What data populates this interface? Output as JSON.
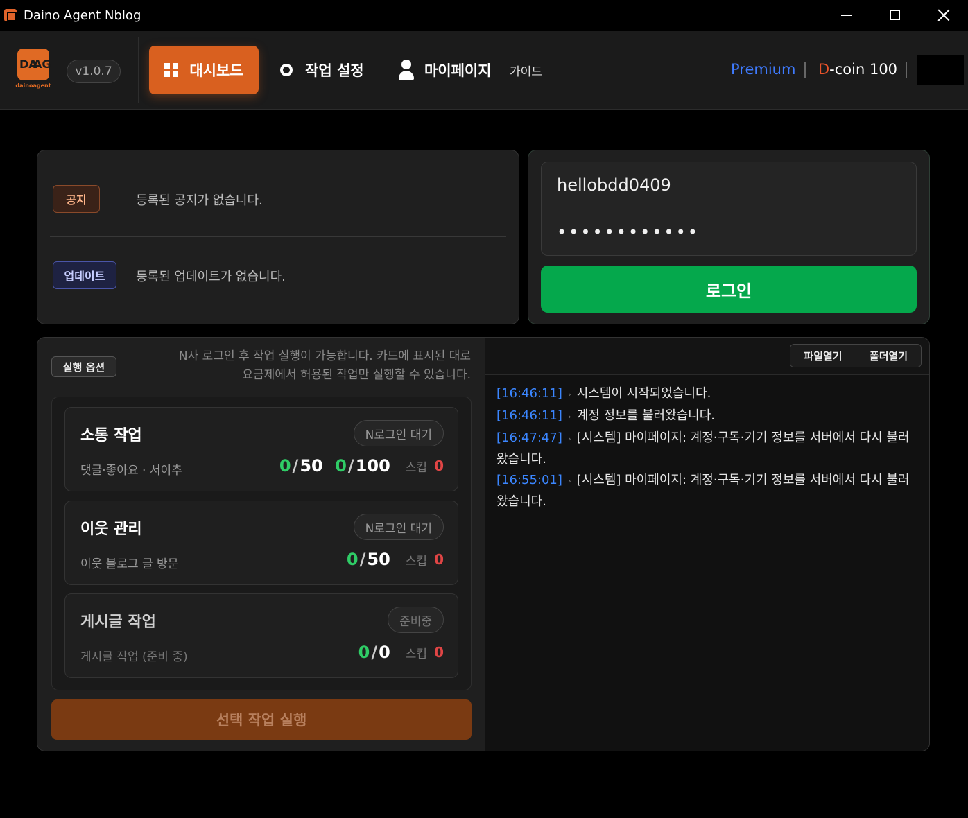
{
  "window": {
    "title": "Daino Agent Nblog"
  },
  "header": {
    "logo_top": "DA",
    "logo_bottom": "AG",
    "logo_sub": "dainoagent",
    "version": "v1.0.7",
    "nav": {
      "dashboard": "대시보드",
      "settings": "작업 설정",
      "mypage": "마이페이지",
      "guide": "가이드"
    },
    "plan": "Premium",
    "dcoin_prefix": "D",
    "dcoin_rest": "-coin 100"
  },
  "notices": {
    "notice_tag": "공지",
    "notice_text": "등록된 공지가 없습니다.",
    "update_tag": "업데이트",
    "update_text": "등록된 업데이트가 없습니다."
  },
  "login": {
    "id_value": "hellobdd0409",
    "pw_value": "••••••••••••",
    "button": "로그인"
  },
  "options": {
    "tag": "실행 옵션",
    "desc_line1": "N사 로그인 후 작업 실행이 가능합니다. 카드에 표시된 대로",
    "desc_line2": "요금제에서 허용된 작업만 실행할 수 있습니다."
  },
  "tasks": [
    {
      "title": "소통 작업",
      "subtitle": "댓글·좋아요 · 서이추",
      "status": "N로그인 대기",
      "count1_done": "0",
      "count1_total": "50",
      "count2_done": "0",
      "count2_total": "100",
      "skip_label": "스킵",
      "skip_value": "0"
    },
    {
      "title": "이웃 관리",
      "subtitle": "이웃 블로그 글 방문",
      "status": "N로그인 대기",
      "count1_done": "0",
      "count1_total": "50",
      "skip_label": "스킵",
      "skip_value": "0"
    },
    {
      "title": "게시글 작업",
      "subtitle": "게시글 작업 (준비 중)",
      "status": "준비중",
      "count1_done": "0",
      "count1_total": "0",
      "skip_label": "스킵",
      "skip_value": "0"
    }
  ],
  "run_button": "선택 작업 실행",
  "log": {
    "open_file": "파일열기",
    "open_folder": "폴더열기",
    "entries": [
      {
        "time": "[16:46:11]",
        "message": "시스템이 시작되었습니다."
      },
      {
        "time": "[16:46:11]",
        "message": "계정 정보를 불러왔습니다."
      },
      {
        "time": "[16:47:47]",
        "message": "[시스템] 마이페이지: 계정·구독·기기 정보를 서버에서 다시 불러왔습니다."
      },
      {
        "time": "[16:55:01]",
        "message": "[시스템] 마이페이지: 계정·구독·기기 정보를 서버에서 다시 불러왔습니다."
      }
    ]
  },
  "colors": {
    "accent": "#d9601f",
    "login_green": "#05a84c",
    "count_green": "#2fcc66",
    "skip_red": "#e04545",
    "plan_blue": "#3f7bff",
    "log_time_blue": "#3b86ff"
  }
}
